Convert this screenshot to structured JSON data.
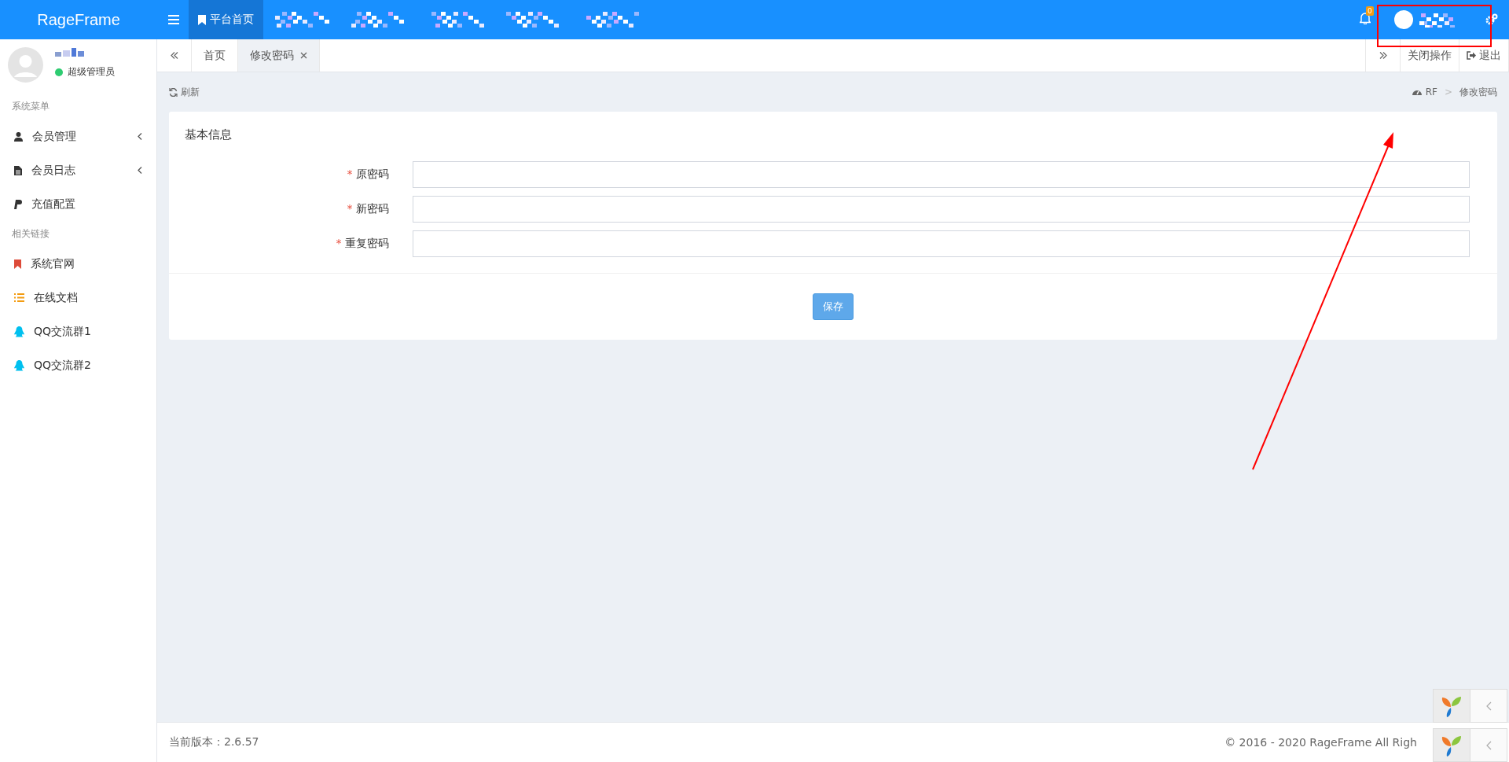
{
  "brand": "RageFrame",
  "top_nav": [
    {
      "kind": "text",
      "label": "平台首页",
      "selected": true
    },
    {
      "kind": "redacted",
      "selected": false
    },
    {
      "kind": "redacted",
      "selected": false
    },
    {
      "kind": "redacted",
      "selected": false
    },
    {
      "kind": "redacted",
      "selected": false
    },
    {
      "kind": "redacted",
      "selected": false
    }
  ],
  "notification": {
    "badge": "0"
  },
  "user": {
    "role": "超级管理员"
  },
  "sidebar": {
    "sections": [
      {
        "heading": "系统菜单",
        "items": [
          {
            "label": "会员管理",
            "kind": "user",
            "expandable": true
          },
          {
            "label": "会员日志",
            "kind": "file",
            "expandable": true
          },
          {
            "label": "充值配置",
            "kind": "paypal",
            "expandable": false
          }
        ]
      },
      {
        "heading": "相关链接",
        "items": [
          {
            "label": "系统官网",
            "kind": "bookmark",
            "expandable": false
          },
          {
            "label": "在线文档",
            "kind": "list",
            "expandable": false
          },
          {
            "label": "QQ交流群1",
            "kind": "qq",
            "expandable": false
          },
          {
            "label": "QQ交流群2",
            "kind": "qq",
            "expandable": false
          }
        ]
      }
    ]
  },
  "tabs": [
    {
      "label": "首页",
      "selected": false,
      "closable": false
    },
    {
      "label": "修改密码",
      "selected": true,
      "closable": true
    }
  ],
  "tab_actions": [
    {
      "kind": "close_ops",
      "label": "关闭操作"
    },
    {
      "kind": "logout",
      "label": "退出"
    }
  ],
  "refresh": "刷新",
  "breadcrumb": {
    "items": [
      "RF",
      "修改密码"
    ],
    "separator": ">"
  },
  "card": {
    "title": "基本信息",
    "fields": [
      {
        "marker": "*",
        "label": "原密码"
      },
      {
        "marker": "*",
        "label": "新密码"
      },
      {
        "marker": "*",
        "label": "重复密码"
      }
    ],
    "button": "保存"
  },
  "footer": {
    "version": "当前版本：2.6.57",
    "copyright": "© 2016 - 2020 RageFrame All Righ"
  }
}
